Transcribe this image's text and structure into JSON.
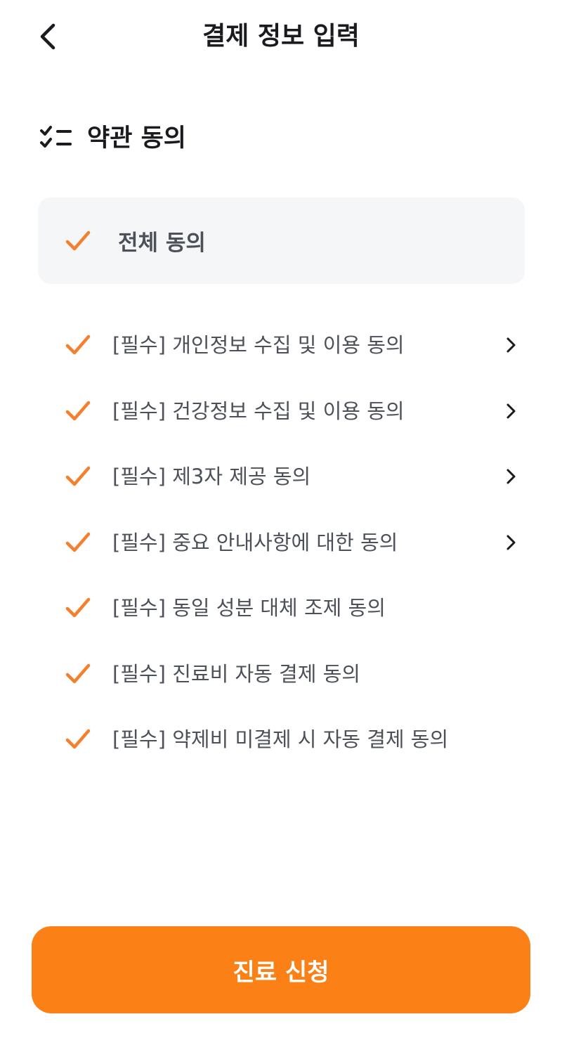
{
  "header": {
    "title": "결제 정보 입력",
    "back_icon": "chevron-left-icon"
  },
  "section": {
    "title": "약관 동의",
    "icon": "checklist-icon"
  },
  "all_agree": {
    "label": "전체 동의",
    "checked": true
  },
  "terms": [
    {
      "label": "[필수] 개인정보 수집 및 이용 동의",
      "checked": true,
      "has_detail": true
    },
    {
      "label": "[필수] 건강정보 수집 및 이용 동의",
      "checked": true,
      "has_detail": true
    },
    {
      "label": "[필수] 제3자 제공 동의",
      "checked": true,
      "has_detail": true
    },
    {
      "label": "[필수] 중요 안내사항에 대한 동의",
      "checked": true,
      "has_detail": true
    },
    {
      "label": "[필수] 동일 성분 대체 조제 동의",
      "checked": true,
      "has_detail": false
    },
    {
      "label": "[필수] 진료비 자동 결제 동의",
      "checked": true,
      "has_detail": false
    },
    {
      "label": "[필수] 약제비 미결제 시 자동 결제 동의",
      "checked": true,
      "has_detail": false
    }
  ],
  "cta": {
    "label": "진료 신청"
  },
  "colors": {
    "accent": "#fb8117",
    "check": "#f47f2c",
    "text_secondary": "#4c5159",
    "panel_bg": "#f5f6f8"
  }
}
